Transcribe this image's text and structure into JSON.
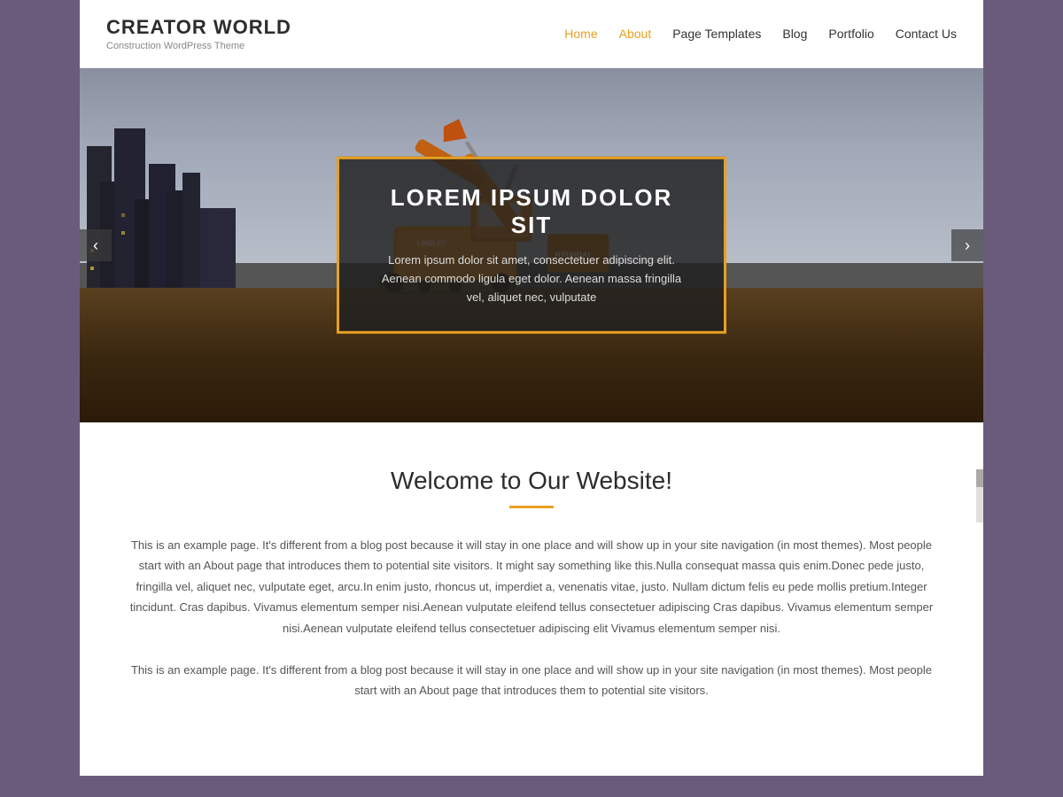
{
  "site": {
    "title": "CREATOR WORLD",
    "subtitle": "Construction WordPress Theme"
  },
  "nav": {
    "items": [
      {
        "label": "Home",
        "class": "home",
        "active": false
      },
      {
        "label": "About",
        "class": "about",
        "active": true
      },
      {
        "label": "Page Templates",
        "class": "",
        "active": false
      },
      {
        "label": "Blog",
        "class": "",
        "active": false
      },
      {
        "label": "Portfolio",
        "class": "",
        "active": false
      },
      {
        "label": "Contact Us",
        "class": "",
        "active": false
      }
    ]
  },
  "hero": {
    "title": "LOREM IPSUM DOLOR SIT",
    "description": "Lorem ipsum dolor sit amet, consectetuer adipiscing elit. Aenean commodo ligula eget dolor. Aenean massa fringilla vel, aliquet nec, vulputate",
    "prev_label": "‹",
    "next_label": "›"
  },
  "content": {
    "title": "Welcome to Our Website!",
    "paragraph1": "This is an example page. It's different from a blog post because it will stay in one place and will show up in your site navigation (in most themes). Most people start with an About page that introduces them to potential site visitors. It might say something like this.Nulla consequat massa quis enim.Donec pede justo, fringilla vel, aliquet nec, vulputate eget, arcu.In enim justo, rhoncus ut, imperdiet a, venenatis vitae, justo. Nullam dictum felis eu pede mollis pretium.Integer tincidunt. Cras dapibus. Vivamus elementum semper nisi.Aenean vulputate eleifend tellus consectetuer adipiscing Cras dapibus. Vivamus elementum semper nisi.Aenean vulputate eleifend tellus consectetuer adipiscing elit Vivamus elementum semper nisi.",
    "paragraph2": "This is an example page. It's different from a blog post because it will stay in one place and will show up in your site navigation (in most themes). Most people start with an About page that introduces them to potential site visitors."
  }
}
